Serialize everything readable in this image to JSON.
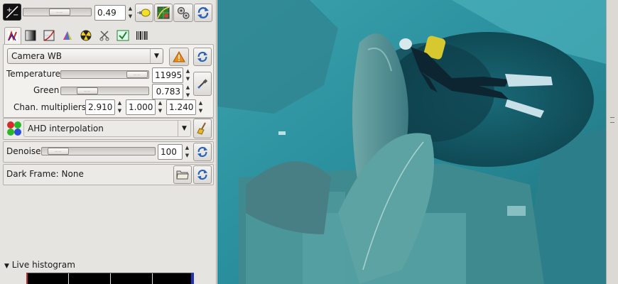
{
  "exposure": {
    "value": "0.49",
    "icon": "exposure-plus-minus-icon"
  },
  "toolbar_icons": [
    "auto-exposure-bulb-icon",
    "tone-curve-grid-icon",
    "settings-gears-icon",
    "reset-refresh-icon"
  ],
  "tabs": [
    {
      "name": "tab-raw",
      "icon": "raw-levels-icon"
    },
    {
      "name": "tab-grayscale",
      "icon": "grayscale-icon"
    },
    {
      "name": "tab-base-curve",
      "icon": "base-curve-icon"
    },
    {
      "name": "tab-color",
      "icon": "color-prism-icon"
    },
    {
      "name": "tab-lens",
      "icon": "lens-radiation-icon"
    },
    {
      "name": "tab-crop",
      "icon": "scissors-crop-icon"
    },
    {
      "name": "tab-save",
      "icon": "save-checkbox-icon"
    },
    {
      "name": "tab-exif",
      "icon": "exif-barcode-icon"
    }
  ],
  "white_balance": {
    "preset": "Camera WB",
    "warning_icon": "warning-triangle-icon",
    "temperature_label": "Temperature",
    "temperature_value": "11995",
    "green_label": "Green",
    "green_value": "0.783",
    "multipliers_label": "Chan. multipliers:",
    "multipliers": [
      "2.910",
      "1.000",
      "1.240"
    ]
  },
  "interpolation": {
    "value": "AHD interpolation",
    "icon": "color-dots-icon"
  },
  "denoise": {
    "label": "Denoise",
    "value": "100"
  },
  "dark_frame": {
    "label": "Dark Frame: None"
  },
  "histogram": {
    "label": "Live histogram"
  },
  "photo": {
    "subject": "underwater-diver-propeller",
    "water_color": "#2a8e9c",
    "shadow_color": "#0f4a55"
  }
}
